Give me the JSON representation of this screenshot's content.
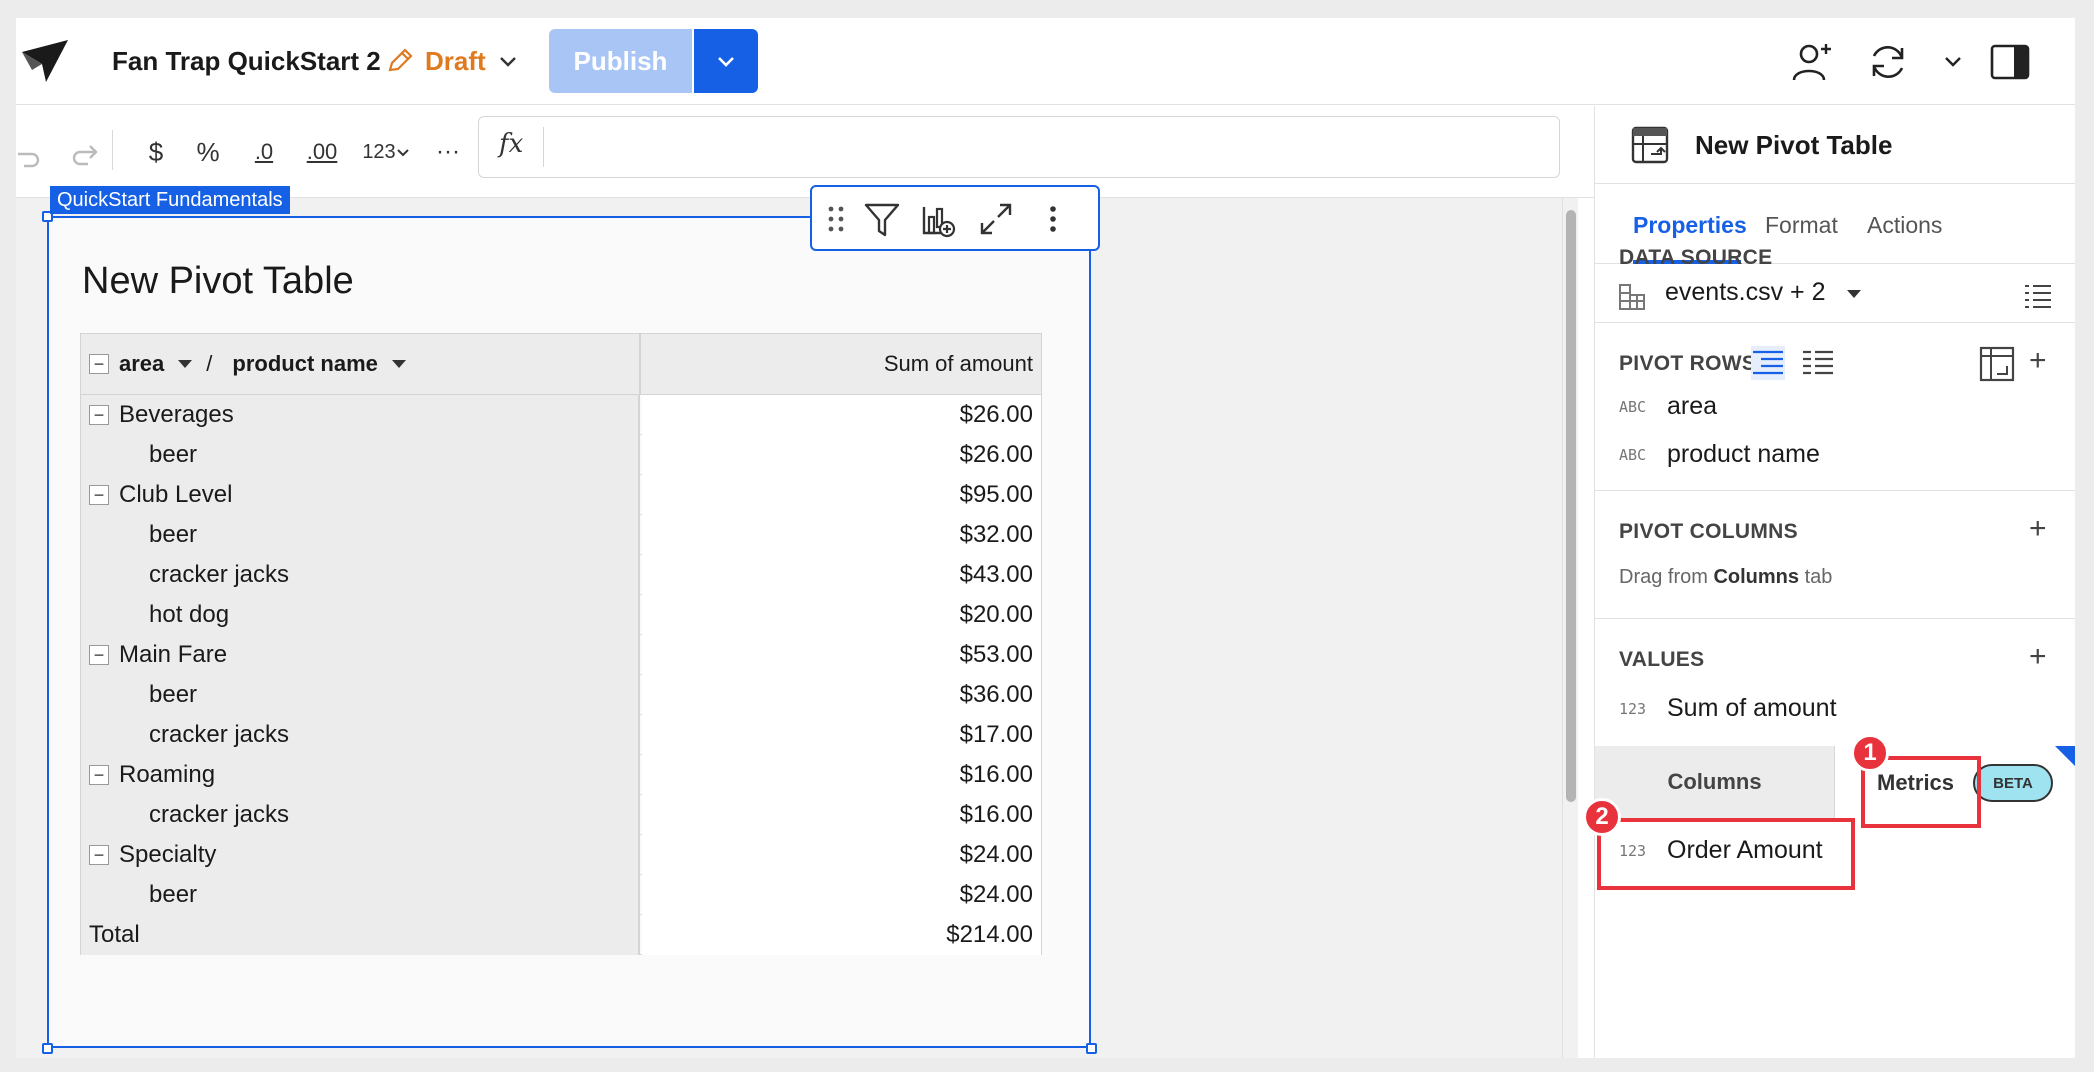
{
  "header": {
    "workbook_title": "Fan Trap QuickStart 2",
    "status": "Draft",
    "publish_label": "Publish"
  },
  "toolbar": {
    "items": [
      "$",
      "%",
      ".0",
      ".00",
      "123",
      "···"
    ],
    "formula_icon": "fx",
    "formula_value": ""
  },
  "canvas": {
    "container_tag": "QuickStart Fundamentals",
    "element_title": "New Pivot Table"
  },
  "pivot": {
    "row_headers": [
      "area",
      "product name"
    ],
    "separator": "/",
    "value_header": "Sum of amount",
    "rows": [
      {
        "label": "Beverages",
        "value": "$26.00",
        "level": 0
      },
      {
        "label": "beer",
        "value": "$26.00",
        "level": 1
      },
      {
        "label": "Club Level",
        "value": "$95.00",
        "level": 0
      },
      {
        "label": "beer",
        "value": "$32.00",
        "level": 1
      },
      {
        "label": "cracker jacks",
        "value": "$43.00",
        "level": 1
      },
      {
        "label": "hot dog",
        "value": "$20.00",
        "level": 1
      },
      {
        "label": "Main Fare",
        "value": "$53.00",
        "level": 0
      },
      {
        "label": "beer",
        "value": "$36.00",
        "level": 1
      },
      {
        "label": "cracker jacks",
        "value": "$17.00",
        "level": 1
      },
      {
        "label": "Roaming",
        "value": "$16.00",
        "level": 0
      },
      {
        "label": "cracker jacks",
        "value": "$16.00",
        "level": 1
      },
      {
        "label": "Specialty",
        "value": "$24.00",
        "level": 0
      },
      {
        "label": "beer",
        "value": "$24.00",
        "level": 1
      }
    ],
    "total_label": "Total",
    "total_value": "$214.00"
  },
  "panel": {
    "title": "New Pivot Table",
    "tabs": [
      "Properties",
      "Format",
      "Actions"
    ],
    "active_tab": "Properties",
    "data_source_label": "DATA SOURCE",
    "data_source_name": "events.csv + 2",
    "pivot_rows_label": "PIVOT ROWS",
    "pivot_rows": [
      {
        "type": "ABC",
        "name": "area"
      },
      {
        "type": "ABC",
        "name": "product name"
      }
    ],
    "pivot_columns_label": "PIVOT COLUMNS",
    "drag_hint_prefix": "Drag from",
    "drag_hint_bold": "Columns",
    "drag_hint_suffix": "tab",
    "values_label": "VALUES",
    "values": [
      {
        "type": "123",
        "name": "Sum of amount"
      }
    ],
    "subtab_columns": "Columns",
    "subtab_metrics": "Metrics",
    "beta_badge": "BETA",
    "metrics": [
      {
        "type": "123",
        "name": "Order Amount"
      }
    ]
  },
  "annotations": [
    "1",
    "2"
  ],
  "colors": {
    "accent": "#1660e6",
    "draft": "#e07a1f",
    "callout": "#e8323c"
  }
}
